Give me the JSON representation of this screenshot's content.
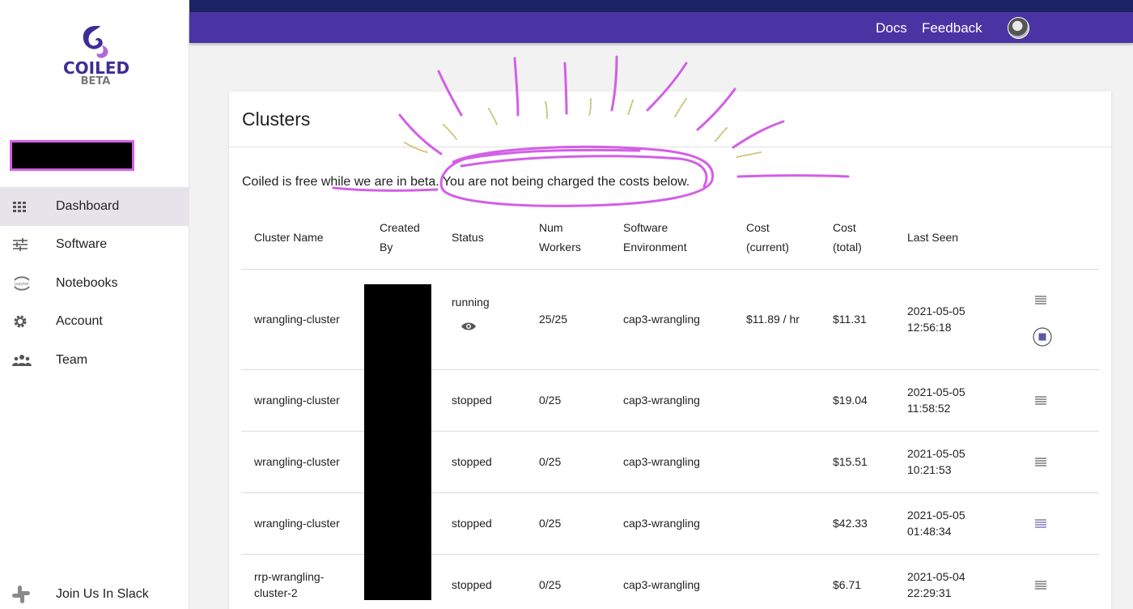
{
  "app": {
    "brand": "COILED",
    "brand_sub": "BETA"
  },
  "sidebar": {
    "items": [
      {
        "label": "Dashboard",
        "icon": "grid-icon",
        "active": true
      },
      {
        "label": "Software",
        "icon": "sliders-icon",
        "active": false
      },
      {
        "label": "Notebooks",
        "icon": "jupyter-icon",
        "active": false
      },
      {
        "label": "Account",
        "icon": "gear-icon",
        "active": false
      },
      {
        "label": "Team",
        "icon": "team-icon",
        "active": false
      }
    ],
    "slack_label": "Join Us In Slack"
  },
  "topbar": {
    "docs": "Docs",
    "feedback": "Feedback"
  },
  "page": {
    "title": "Clusters",
    "beta_note": "Coiled is free while we are in beta. You are not being charged the costs below."
  },
  "table": {
    "headers": [
      {
        "line1": "Cluster Name",
        "line2": ""
      },
      {
        "line1": "Created",
        "line2": "By"
      },
      {
        "line1": "Status",
        "line2": ""
      },
      {
        "line1": "Num",
        "line2": "Workers"
      },
      {
        "line1": "Software",
        "line2": "Environment"
      },
      {
        "line1": "Cost",
        "line2": "(current)"
      },
      {
        "line1": "Cost",
        "line2": "(total)"
      },
      {
        "line1": "Last Seen",
        "line2": ""
      }
    ],
    "rows": [
      {
        "name": "wrangling-cluster",
        "status": "running",
        "workers": "25/25",
        "env": "cap3-wrangling",
        "cost_current": "$11.89 / hr",
        "cost_total": "$11.31",
        "last_seen_date": "2021-05-05",
        "last_seen_time": "12:56:18"
      },
      {
        "name": "wrangling-cluster",
        "status": "stopped",
        "workers": "0/25",
        "env": "cap3-wrangling",
        "cost_current": "",
        "cost_total": "$19.04",
        "last_seen_date": "2021-05-05",
        "last_seen_time": "11:58:52"
      },
      {
        "name": "wrangling-cluster",
        "status": "stopped",
        "workers": "0/25",
        "env": "cap3-wrangling",
        "cost_current": "",
        "cost_total": "$15.51",
        "last_seen_date": "2021-05-05",
        "last_seen_time": "10:21:53"
      },
      {
        "name": "wrangling-cluster",
        "status": "stopped",
        "workers": "0/25",
        "env": "cap3-wrangling",
        "cost_current": "",
        "cost_total": "$42.33",
        "last_seen_date": "2021-05-05",
        "last_seen_time": "01:48:34"
      },
      {
        "name_line1": "rrp-wrangling-",
        "name_line2": "cluster-2",
        "status": "stopped",
        "workers": "0/25",
        "env": "cap3-wrangling",
        "cost_current": "",
        "cost_total": "$6.71",
        "last_seen_date": "2021-05-04",
        "last_seen_time": "22:29:31"
      }
    ]
  },
  "colors": {
    "header_bar": "#4a33a3",
    "header_top": "#1c2465",
    "brand": "#3d2d96",
    "annotation": "#d35fe6"
  }
}
